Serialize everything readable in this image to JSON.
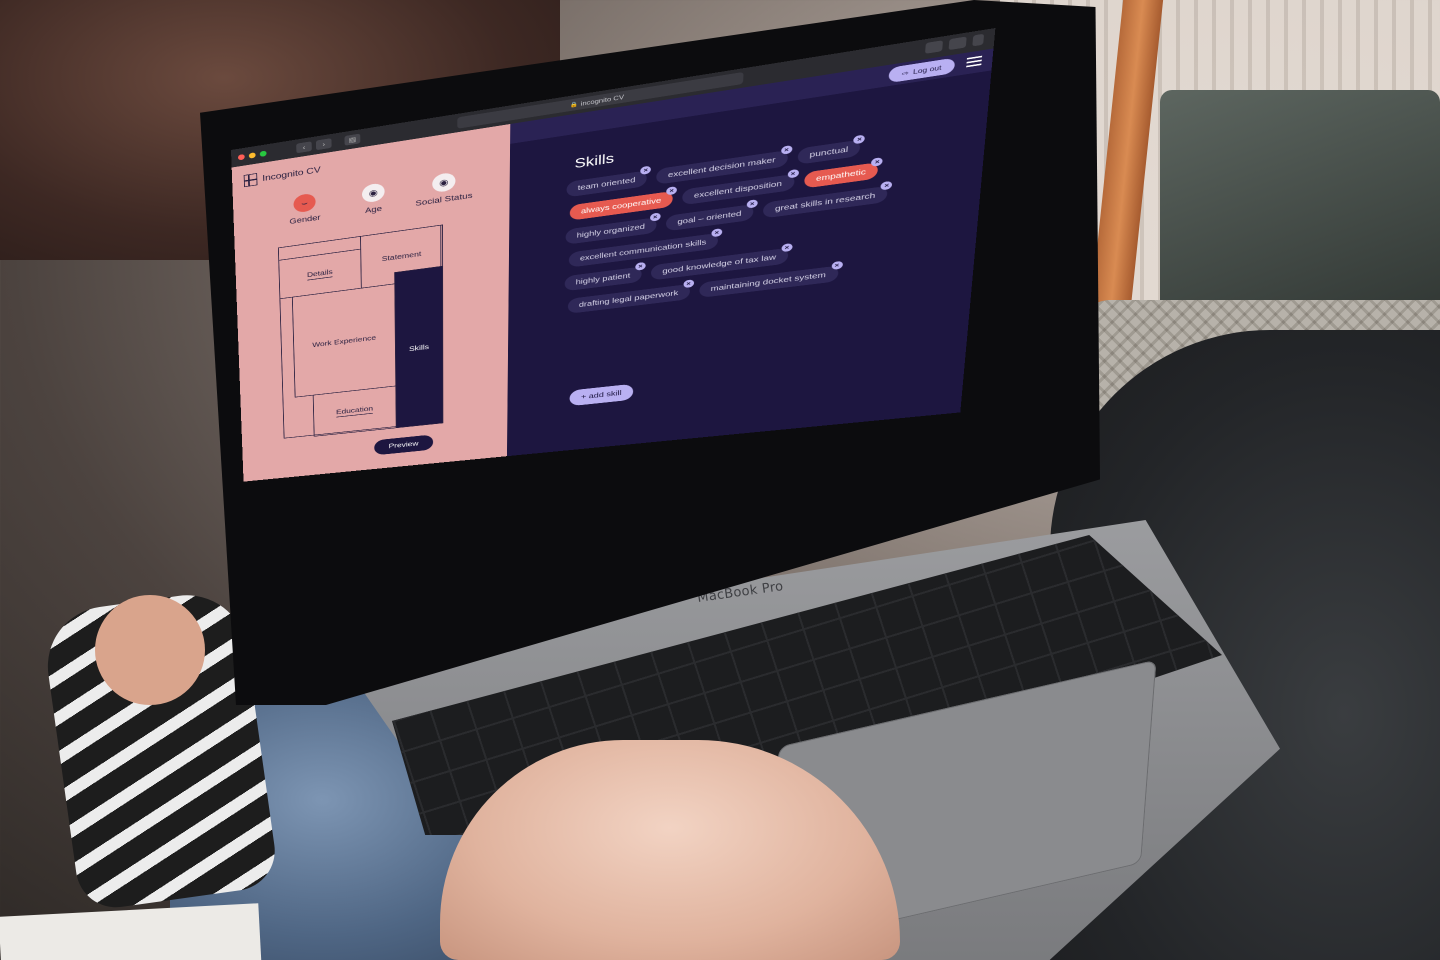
{
  "browser": {
    "url": "incognito CV",
    "traffic_lights": [
      "#ff5f57",
      "#febc2e",
      "#28c840"
    ]
  },
  "app": {
    "name": "Incognito CV",
    "colors": {
      "left_bg": "#e3a8a8",
      "right_bg": "#1d1640",
      "accent": "#e65a50",
      "lavender": "#b9b0f2"
    }
  },
  "filters": [
    {
      "label": "Gender",
      "state": "hidden",
      "icon": "closed-eye-icon"
    },
    {
      "label": "Age",
      "state": "visible",
      "icon": "eye-icon"
    },
    {
      "label": "Social Status",
      "state": "visible",
      "icon": "eye-icon"
    }
  ],
  "cv_sections": {
    "details": "Details",
    "statement": "Statement",
    "work": "Work Experience",
    "skills": "Skills",
    "education": "Education"
  },
  "preview_label": "Preview",
  "header": {
    "logout_label": "Log out"
  },
  "skills": {
    "title": "Skills",
    "add_label": "+ add skill",
    "rows": [
      [
        {
          "label": "team oriented",
          "hl": false
        },
        {
          "label": "excellent decision maker",
          "hl": false
        },
        {
          "label": "punctual",
          "hl": false
        }
      ],
      [
        {
          "label": "always cooperative",
          "hl": true
        },
        {
          "label": "excellent disposition",
          "hl": false
        },
        {
          "label": "empathetic",
          "hl": true
        }
      ],
      [
        {
          "label": "highly organized",
          "hl": false
        },
        {
          "label": "goal – oriented",
          "hl": false
        },
        {
          "label": "great skills in research",
          "hl": false
        }
      ],
      [
        {
          "label": "excellent communication skills",
          "hl": false
        }
      ],
      [
        {
          "label": "highly patient",
          "hl": false
        },
        {
          "label": "good knowledge of tax law",
          "hl": false
        }
      ],
      [
        {
          "label": "drafting legal paperwork",
          "hl": false
        },
        {
          "label": "maintaining docket system",
          "hl": false
        }
      ]
    ]
  },
  "laptop_label": "MacBook Pro"
}
